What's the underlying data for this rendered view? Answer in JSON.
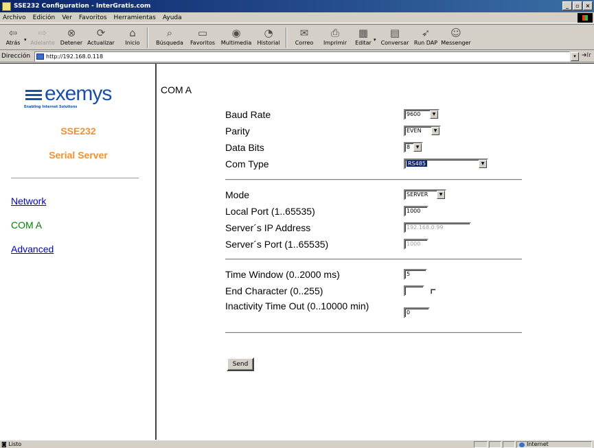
{
  "window": {
    "title": "SSE232 Configuration - InterGratis.com",
    "controls": [
      "_",
      "▫",
      "×"
    ]
  },
  "menubar": [
    "Archivo",
    "Edición",
    "Ver",
    "Favoritos",
    "Herramientas",
    "Ayuda"
  ],
  "toolbar": {
    "back": "Atrás",
    "forward": "Adelante",
    "stop": "Detener",
    "refresh": "Actualizar",
    "home": "Inicio",
    "search": "Búsqueda",
    "favorites": "Favoritos",
    "media": "Multimedia",
    "history": "Historial",
    "mail": "Correo",
    "print": "Imprimir",
    "edit": "Editar",
    "discuss": "Conversar",
    "run_dap": "Run DAP",
    "messenger": "Messenger"
  },
  "address": {
    "label": "Dirección",
    "url": "http://192.168.0.118",
    "go": "Ir"
  },
  "sidebar": {
    "logo_word": "exemys",
    "logo_tagline": "Enabling Internet Solutions",
    "product": "SSE232",
    "subtitle": "Serial Server",
    "nav": [
      {
        "label": "Network"
      },
      {
        "label": "COM A"
      },
      {
        "label": "Advanced"
      }
    ]
  },
  "form": {
    "heading": "COM A",
    "baud_rate": {
      "label": "Baud Rate",
      "value": "9600"
    },
    "parity": {
      "label": "Parity",
      "value": "EVEN"
    },
    "data_bits": {
      "label": "Data Bits",
      "value": "8"
    },
    "com_type": {
      "label": "Com Type",
      "value": "RS485"
    },
    "mode": {
      "label": "Mode",
      "value": "SERVER"
    },
    "local_port": {
      "label": "Local Port (1..65535)",
      "value": "1000"
    },
    "server_ip": {
      "label": "Server´s IP Address",
      "value": "192.168.0.99"
    },
    "server_port": {
      "label": "Server´s Port (1..65535)",
      "value": "1000"
    },
    "time_window": {
      "label": "Time Window (0..2000 ms)",
      "value": "5"
    },
    "end_char": {
      "label": "End Character (0..255)",
      "value": ""
    },
    "inactivity": {
      "label": "Inactivity Time Out (0..10000 min)",
      "value": "0"
    },
    "send": "Send"
  },
  "status": {
    "text": "Listo",
    "zone": "Internet"
  },
  "colors": {
    "titlebar": "#0a246a",
    "link": "#0000cc",
    "current": "#008000",
    "accent": "#f09030",
    "brand": "#1a4fa8"
  }
}
